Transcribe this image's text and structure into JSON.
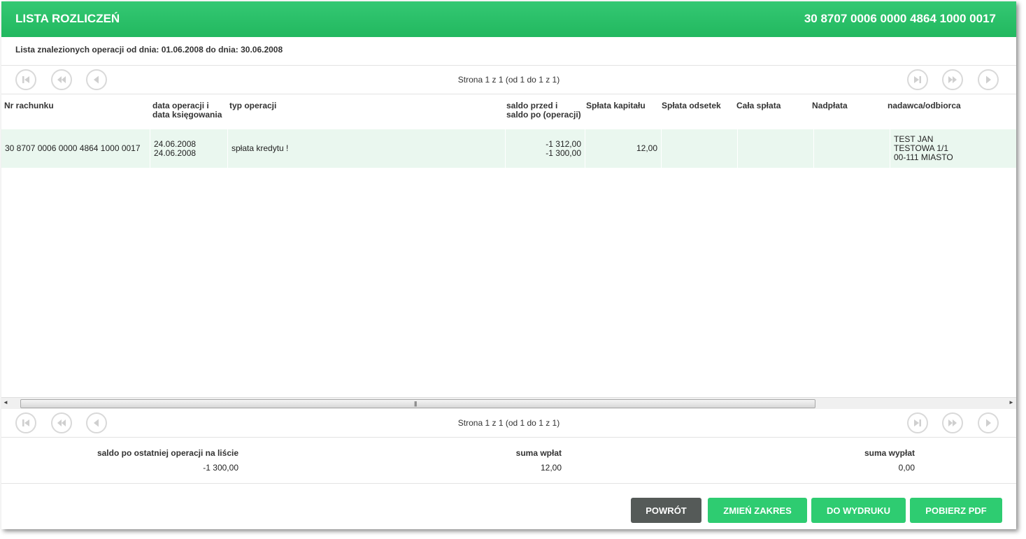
{
  "header": {
    "title": "LISTA ROZLICZEŃ",
    "account": "30 8707 0006 0000 4864 1000 0017"
  },
  "subtitle": "Lista znalezionych operacji od dnia: 01.06.2008 do dnia: 30.06.2008",
  "pager": {
    "text": "Strona 1 z 1 (od 1 do 1 z 1)"
  },
  "table": {
    "columns": [
      "Nr rachunku",
      "data operacji i\ndata księgowania",
      "typ operacji",
      "saldo przed i\nsaldo po (operacji)",
      "Spłata kapitału",
      "Spłata odsetek",
      "Cała spłata",
      "Nadpłata",
      "nadawca/odbiorca"
    ],
    "rows": [
      {
        "account": "30 8707 0006 0000 4864 1000 0017",
        "date_op": "24.06.2008",
        "date_book": "24.06.2008",
        "type": "spłata kredytu !",
        "saldo_before": "-1 312,00",
        "saldo_after": "-1 300,00",
        "capital": "12,00",
        "interest": "",
        "total": "",
        "overpay": "",
        "party_line1": "TEST JAN",
        "party_line2": "TESTOWA 1/1",
        "party_line3": "00-111 MIASTO"
      }
    ]
  },
  "summary": {
    "last_balance_label": "saldo po ostatniej operacji na liście",
    "last_balance_value": "-1 300,00",
    "deposits_label": "suma wpłat",
    "deposits_value": "12,00",
    "withdrawals_label": "suma wypłat",
    "withdrawals_value": "0,00"
  },
  "buttons": {
    "back": "POWRÓT",
    "change_range": "ZMIEŃ ZAKRES",
    "print": "DO WYDRUKU",
    "pdf": "POBIERZ PDF"
  },
  "colors": {
    "header_green": "#2ecc71",
    "row_highlight": "#eaf7ef",
    "back_button": "#555a58"
  }
}
